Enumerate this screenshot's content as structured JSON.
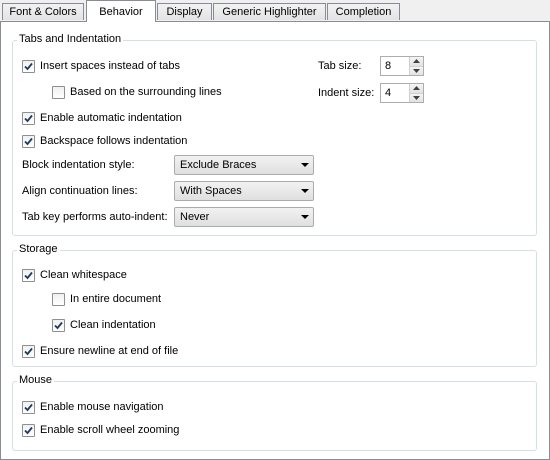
{
  "tabs": [
    {
      "label": "Font & Colors"
    },
    {
      "label": "Behavior",
      "active": true
    },
    {
      "label": "Display"
    },
    {
      "label": "Generic Highlighter"
    },
    {
      "label": "Completion"
    }
  ],
  "tabs_indent": {
    "title": "Tabs and Indentation",
    "insert_spaces": {
      "label": "Insert spaces instead of tabs",
      "checked": true
    },
    "based_on_surrounding": {
      "label": "Based on the surrounding lines",
      "checked": false
    },
    "auto_indent": {
      "label": "Enable automatic indentation",
      "checked": true
    },
    "backspace_follows": {
      "label": "Backspace follows indentation",
      "checked": true
    },
    "tab_size": {
      "label": "Tab size:",
      "value": "8"
    },
    "indent_size": {
      "label": "Indent size:",
      "value": "4"
    },
    "block_style": {
      "label": "Block indentation style:",
      "value": "Exclude Braces"
    },
    "align_continuation": {
      "label": "Align continuation lines:",
      "value": "With Spaces"
    },
    "tab_key_auto_indent": {
      "label": "Tab key performs auto-indent:",
      "value": "Never"
    }
  },
  "storage": {
    "title": "Storage",
    "clean_whitespace": {
      "label": "Clean whitespace",
      "checked": true
    },
    "entire_document": {
      "label": "In entire document",
      "checked": false
    },
    "clean_indentation": {
      "label": "Clean indentation",
      "checked": true
    },
    "ensure_newline": {
      "label": "Ensure newline at end of file",
      "checked": true
    }
  },
  "mouse": {
    "title": "Mouse",
    "mouse_navigation": {
      "label": "Enable mouse navigation",
      "checked": true
    },
    "scroll_zoom": {
      "label": "Enable scroll wheel zooming",
      "checked": true
    }
  },
  "colors": {
    "border": "#898c95",
    "check": "#1f3a5f"
  },
  "icons": {
    "checkmark": "checkmark-icon",
    "combo_arrow": "chevron-down-icon",
    "spin_up": "spin-up-icon",
    "spin_down": "spin-down-icon"
  }
}
